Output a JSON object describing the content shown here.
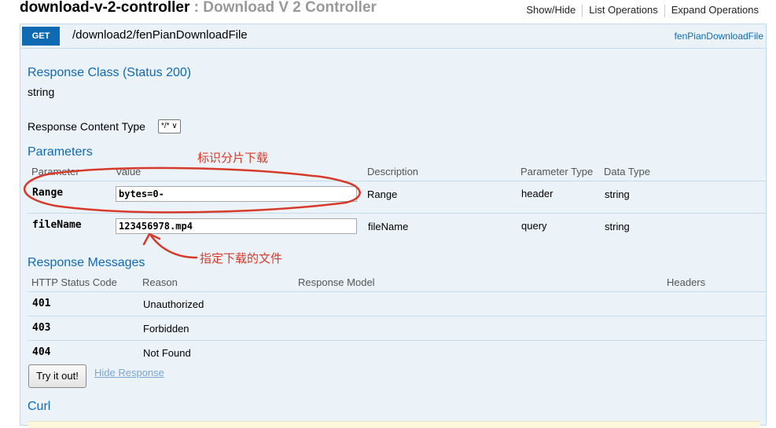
{
  "header": {
    "controller_name": "download-v-2-controller",
    "separator": " : ",
    "controller_desc": "Download V 2 Controller",
    "links": [
      "Show/Hide",
      "List Operations",
      "Expand Operations"
    ]
  },
  "endpoint": {
    "method": "GET",
    "path": "/download2/fenPianDownloadFile",
    "nickname": "fenPianDownloadFile"
  },
  "response_class": {
    "title": "Response Class (Status 200)",
    "type": "string"
  },
  "content_type": {
    "label": "Response Content Type",
    "selected": "*/* ∨"
  },
  "parameters": {
    "title": "Parameters",
    "headers": [
      "Parameter",
      "Value",
      "Description",
      "Parameter Type",
      "Data Type"
    ],
    "rows": [
      {
        "name": "Range",
        "value": "bytes=0-",
        "description": "Range",
        "param_type": "header",
        "data_type": "string"
      },
      {
        "name": "fileName",
        "value": "123456978.mp4",
        "description": "fileName",
        "param_type": "query",
        "data_type": "string"
      }
    ]
  },
  "annotations": {
    "range_note": "标识分片下载",
    "file_note": "指定下载的文件"
  },
  "response_messages": {
    "title": "Response Messages",
    "headers": [
      "HTTP Status Code",
      "Reason",
      "Response Model",
      "Headers"
    ],
    "rows": [
      {
        "code": "401",
        "reason": "Unauthorized"
      },
      {
        "code": "403",
        "reason": "Forbidden"
      },
      {
        "code": "404",
        "reason": "Not Found"
      }
    ]
  },
  "actions": {
    "try_label": "Try it out!",
    "hide_label": "Hide Response"
  },
  "curl": {
    "title": "Curl"
  },
  "colors": {
    "get_method": "#0f6ab4",
    "panel_bg": "#ebf3f9",
    "annotation": "#d63a2a"
  }
}
